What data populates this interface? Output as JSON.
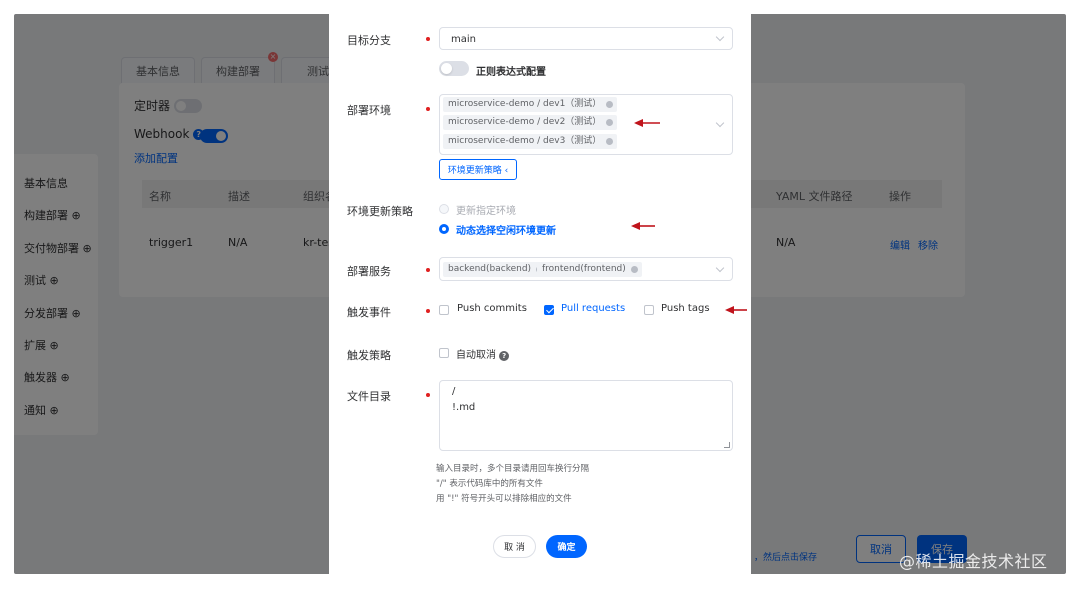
{
  "background": {
    "tabs": [
      "基本信息",
      "构建部署",
      "测试"
    ],
    "timer_label": "定时器",
    "webhook_label": "Webhook",
    "add_config": "添加配置",
    "table": {
      "headers": [
        "名称",
        "描述",
        "组织名",
        "YAML 文件路径",
        "操作"
      ],
      "row": {
        "name": "trigger1",
        "desc": "N/A",
        "org": "kr-test",
        "yaml": "N/A",
        "edit": "编辑",
        "remove": "移除"
      }
    },
    "sidebar": [
      "基本信息",
      "构建部署 ⊕",
      "交付物部署 ⊕",
      "测试 ⊕",
      "分发部署 ⊕",
      "扩展 ⊕",
      "触发器 ⊕",
      "通知 ⊕"
    ],
    "hint": "，然后点击保存",
    "cancel": "取消",
    "save": "保存",
    "watermark": "@稀土掘金技术社区"
  },
  "modal": {
    "target_branch": {
      "label": "目标分支",
      "value": "main"
    },
    "regex_toggle_label": "正则表达式配置",
    "deploy_env": {
      "label": "部署环境",
      "chips": [
        "microservice-demo / dev1（测试）",
        "microservice-demo / dev2（测试）",
        "microservice-demo / dev3（测试）"
      ],
      "update_strategy_button": "环境更新策略 ‹"
    },
    "env_update_strategy": {
      "label": "环境更新策略",
      "options": [
        "更新指定环境",
        "动态选择空闲环境更新"
      ],
      "selected": 1
    },
    "deploy_service": {
      "label": "部署服务",
      "chips": [
        "backend(backend)",
        "frontend(frontend)"
      ]
    },
    "trigger_events": {
      "label": "触发事件",
      "options": [
        {
          "text": "Push commits",
          "checked": false
        },
        {
          "text": "Pull requests",
          "checked": true
        },
        {
          "text": "Push tags",
          "checked": false
        }
      ]
    },
    "trigger_strategy": {
      "label": "触发策略",
      "auto_cancel": "自动取消"
    },
    "file_dir": {
      "label": "文件目录",
      "lines": [
        "/",
        "!.md"
      ],
      "hints": [
        "输入目录时，多个目录请用回车换行分隔",
        "\"/\" 表示代码库中的所有文件",
        "用 \"!\" 符号开头可以排除相应的文件"
      ]
    },
    "cancel": "取 消",
    "ok": "确定"
  },
  "colors": {
    "accent": "#0066ff",
    "required": "#e02020",
    "annotation_arrow": "#c0141c"
  }
}
